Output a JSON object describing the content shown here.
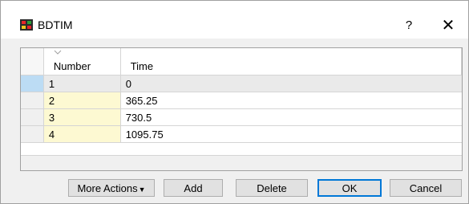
{
  "window": {
    "title": "BDTIM",
    "help_label": "?",
    "close_label": "✕"
  },
  "table": {
    "columns": [
      "Number",
      "Time"
    ],
    "rows": [
      {
        "number": "1",
        "time": "0"
      },
      {
        "number": "2",
        "time": "365.25"
      },
      {
        "number": "3",
        "time": "730.5"
      },
      {
        "number": "4",
        "time": "1095.75"
      }
    ],
    "selected_row": 1
  },
  "buttons": {
    "more_actions": "More Actions",
    "more_actions_caret": "▼",
    "add": "Add",
    "delete": "Delete",
    "ok": "OK",
    "cancel": "Cancel"
  },
  "colors": {
    "highlight_cell": "#fdf9d2",
    "selected_row_header": "#bcdcf4",
    "default_button_border": "#0078d7"
  },
  "icons": {
    "app": "data-table-icon",
    "sort": "sort-indicator-icon"
  }
}
